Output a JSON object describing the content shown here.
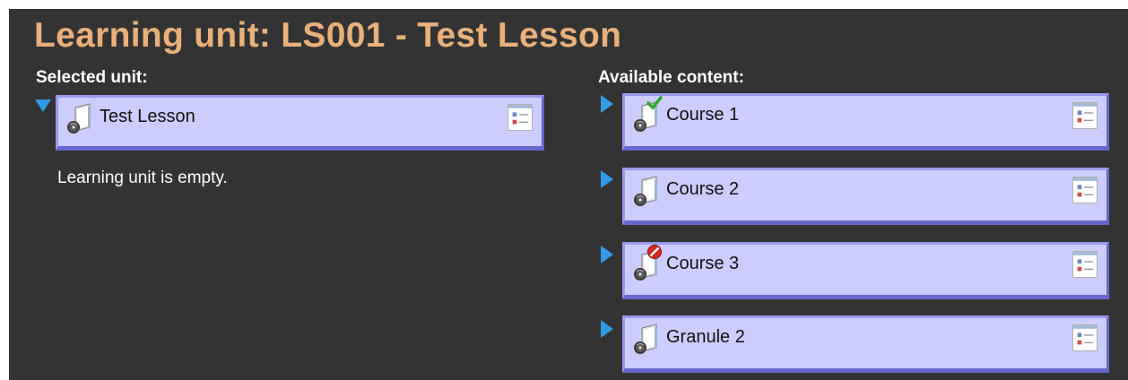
{
  "page": {
    "title": "Learning unit: LS001 - Test Lesson"
  },
  "selected": {
    "label": "Selected unit:",
    "unit": {
      "title": "Test Lesson",
      "icon": "folder-doc-icon",
      "expanded": true
    },
    "empty_message": "Learning unit is empty."
  },
  "available": {
    "label": "Available content:",
    "items": [
      {
        "title": "Course 1",
        "icon": "folder-doc-icon",
        "status": "approved-check",
        "expanded": false
      },
      {
        "title": "Course 2",
        "icon": "folder-doc-icon",
        "status": "none",
        "expanded": false
      },
      {
        "title": "Course 3",
        "icon": "folder-doc-icon",
        "status": "blocked",
        "expanded": false
      },
      {
        "title": "Granule 2",
        "icon": "folder-doc-icon",
        "status": "none",
        "expanded": false
      }
    ]
  },
  "colors": {
    "background": "#333333",
    "title": "#e9b07a",
    "box_fill": "#ccccff",
    "box_border": "#6666cc",
    "expander": "#2f9ae6"
  }
}
